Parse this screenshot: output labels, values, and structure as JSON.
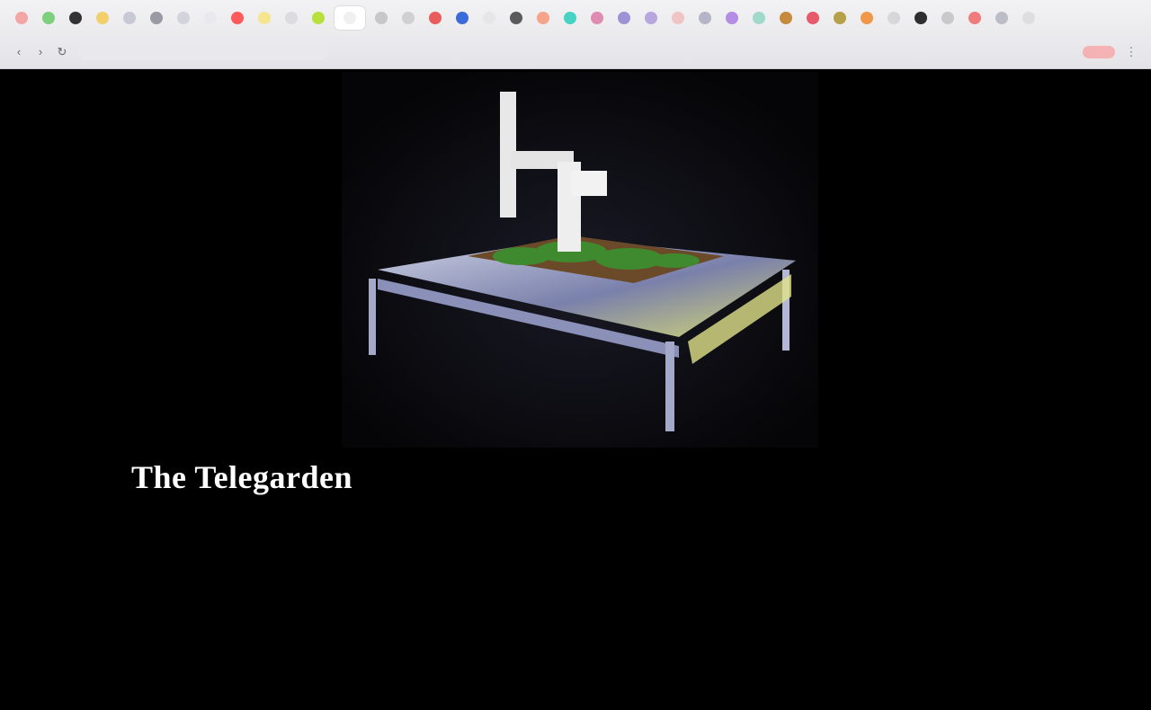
{
  "browser": {
    "tabs": [
      {
        "favicon_color": "#f4a6a6"
      },
      {
        "favicon_color": "#7ed07e"
      },
      {
        "favicon_color": "#333333"
      },
      {
        "favicon_color": "#f2cf6b"
      },
      {
        "favicon_color": "#c9c9d6"
      },
      {
        "favicon_color": "#9a9aa5"
      },
      {
        "favicon_color": "#d3d3dc"
      },
      {
        "favicon_color": "#e8e8ef"
      },
      {
        "favicon_color": "#ff5a5a"
      },
      {
        "favicon_color": "#f6e58d"
      },
      {
        "favicon_color": "#dcdcdc"
      },
      {
        "favicon_color": "#b8e03a"
      },
      {
        "favicon_color": "#f0f0f0",
        "active": true
      },
      {
        "favicon_color": "#c7c7c7"
      },
      {
        "favicon_color": "#d0d0d0"
      },
      {
        "favicon_color": "#e85c5c"
      },
      {
        "favicon_color": "#3b6bd8"
      },
      {
        "favicon_color": "#e6e6e6"
      },
      {
        "favicon_color": "#5a5a5a"
      },
      {
        "favicon_color": "#f5a48a"
      },
      {
        "favicon_color": "#45d3c4"
      },
      {
        "favicon_color": "#e08bb1"
      },
      {
        "favicon_color": "#9b93d6"
      },
      {
        "favicon_color": "#b9a5e0"
      },
      {
        "favicon_color": "#f0c4c4"
      },
      {
        "favicon_color": "#b5b5c7"
      },
      {
        "favicon_color": "#b48be5"
      },
      {
        "favicon_color": "#a0d8c9"
      },
      {
        "favicon_color": "#c68a3c"
      },
      {
        "favicon_color": "#e65a6a"
      },
      {
        "favicon_color": "#b7a148"
      },
      {
        "favicon_color": "#f0974a"
      },
      {
        "favicon_color": "#d7d7d7"
      },
      {
        "favicon_color": "#2e2e2e"
      },
      {
        "favicon_color": "#c9c9c9"
      },
      {
        "favicon_color": "#f07b7b"
      },
      {
        "favicon_color": "#bdbdc7"
      },
      {
        "favicon_color": "#dedede"
      }
    ],
    "icons": {
      "back": "back-arrow-icon",
      "forward": "forward-arrow-icon",
      "reload": "reload-icon",
      "menu": "kebab-menu-icon"
    },
    "extension_color": "#f4b2b5"
  },
  "hero_image": {
    "alt": "The Telegarden robotic garden installation",
    "colors": {
      "soil": "#6b4a2a",
      "plants": "#3f8a2f",
      "table": "#9aa2c8",
      "robot": "#e8e8e8"
    }
  },
  "article": {
    "title": "The Telegarden"
  }
}
